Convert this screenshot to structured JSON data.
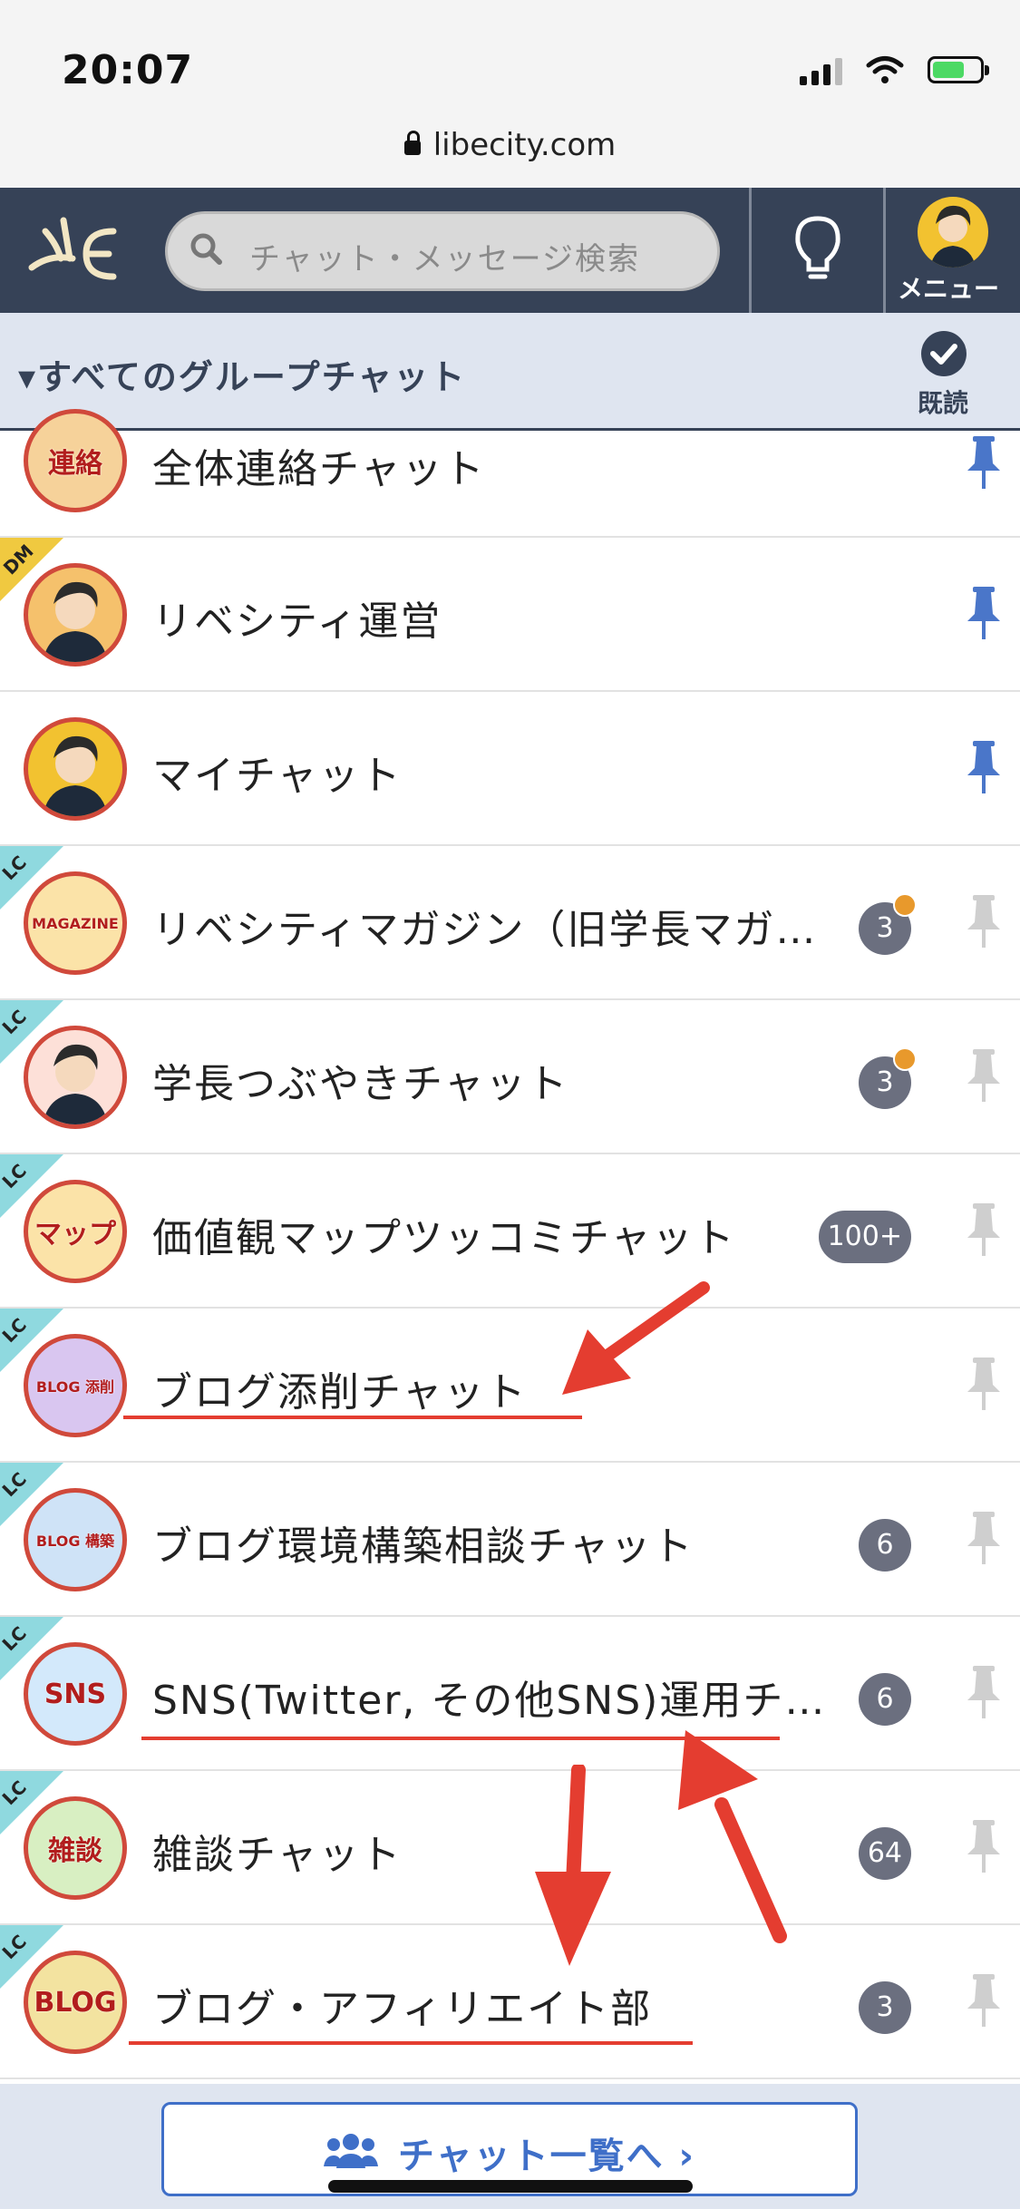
{
  "status": {
    "time": "20:07",
    "url": "libecity.com"
  },
  "header": {
    "search_placeholder": "チャット・メッセージ検索",
    "menu_label": "メニュー"
  },
  "group": {
    "title": "▾すべてのグループチャット",
    "read_label": "既読"
  },
  "chats": [
    {
      "name": "全体連絡チャット",
      "tag": "",
      "avatar_text": "連絡",
      "avatar_bg": "#f6d29a",
      "badge": "",
      "dot": false,
      "pinned": true
    },
    {
      "name": "リベシティ運営",
      "tag": "DM",
      "avatar_text": "",
      "avatar_bg": "#f5c16c",
      "badge": "",
      "dot": false,
      "pinned": true
    },
    {
      "name": "マイチャット",
      "tag": "",
      "avatar_text": "",
      "avatar_bg": "#f2c230",
      "badge": "",
      "dot": false,
      "pinned": true
    },
    {
      "name": "リベシティマガジン（旧学長マガ…",
      "tag": "LC",
      "avatar_text": "MAGAZINE",
      "avatar_bg": "#fbe3a8",
      "badge": "3",
      "dot": true,
      "pinned": false
    },
    {
      "name": "学長つぶやきチャット",
      "tag": "LC",
      "avatar_text": "",
      "avatar_bg": "#fde0d8",
      "badge": "3",
      "dot": true,
      "pinned": false
    },
    {
      "name": "価値観マップツッコミチャット",
      "tag": "LC",
      "avatar_text": "マップ",
      "avatar_bg": "#fbe3a8",
      "badge": "100+",
      "dot": false,
      "pinned": false
    },
    {
      "name": "ブログ添削チャット",
      "tag": "LC",
      "avatar_text": "BLOG 添削",
      "avatar_bg": "#d9c6f0",
      "badge": "",
      "dot": false,
      "pinned": false
    },
    {
      "name": "ブログ環境構築相談チャット",
      "tag": "LC",
      "avatar_text": "BLOG 構築",
      "avatar_bg": "#cfe3f7",
      "badge": "6",
      "dot": false,
      "pinned": false
    },
    {
      "name": "SNS(Twitter, その他SNS)運用チ…",
      "tag": "LC",
      "avatar_text": "SNS",
      "avatar_bg": "#d3e9fb",
      "badge": "6",
      "dot": false,
      "pinned": false
    },
    {
      "name": "雑談チャット",
      "tag": "LC",
      "avatar_text": "雑談",
      "avatar_bg": "#d8efc2",
      "badge": "64",
      "dot": false,
      "pinned": false
    },
    {
      "name": "ブログ・アフィリエイト部",
      "tag": "LC",
      "avatar_text": "BLOG",
      "avatar_bg": "#f3e3a0",
      "badge": "3",
      "dot": false,
      "pinned": false
    }
  ],
  "footer": {
    "button_label": "チャット一覧へ ›"
  },
  "colors": {
    "header_bg": "#364257",
    "accent": "#3f6fc8",
    "annotation_red": "#e43d30",
    "pin_active": "#4a76c9",
    "pin_inactive": "#cfcfcf"
  }
}
